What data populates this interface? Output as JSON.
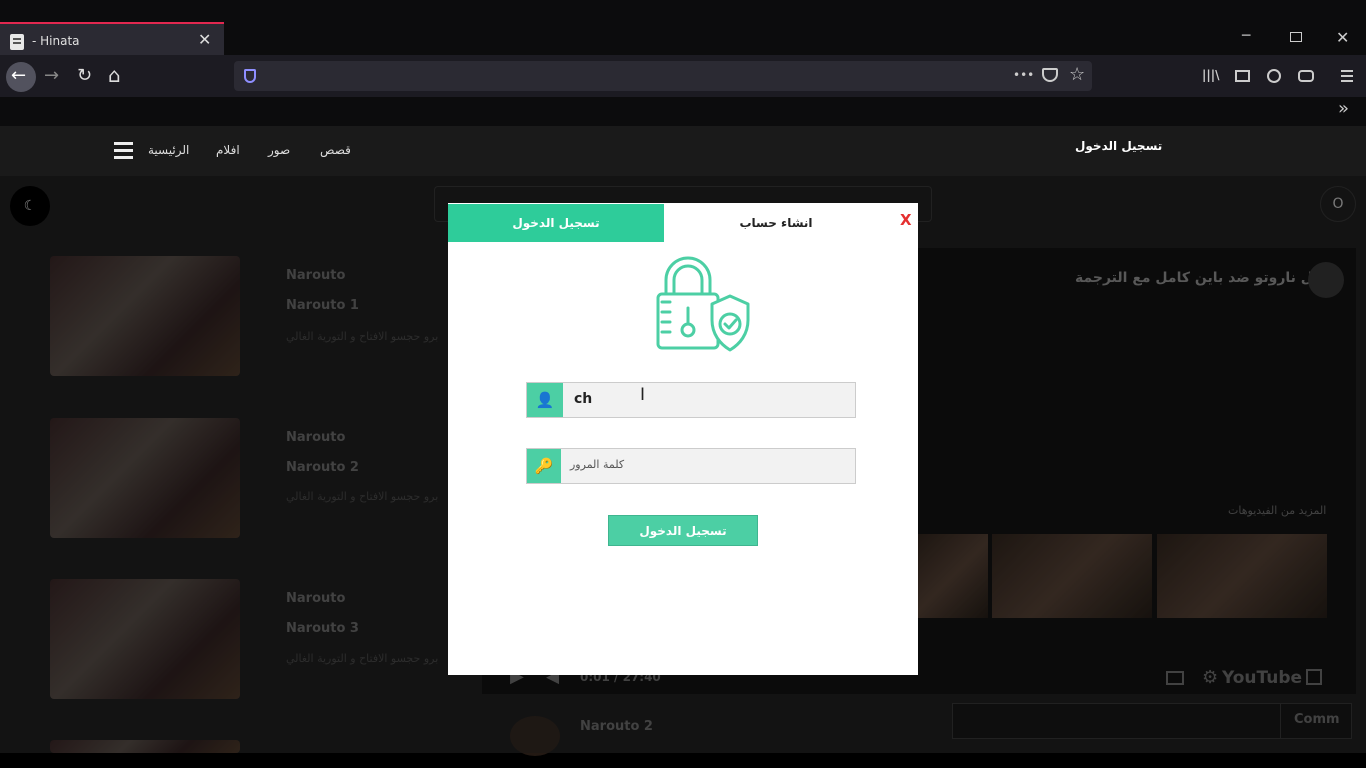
{
  "browser": {
    "tab_title": "- Hinata",
    "tab_close": "✕",
    "window_min": "─",
    "window_close": "✕",
    "nav_back": "←",
    "nav_forward": "→",
    "nav_reload": "↻",
    "nav_home": "⌂",
    "page_actions": "•••",
    "library": "|||\\",
    "bookmarks_more": "»"
  },
  "site_header": {
    "nav_links": [
      "الرئيسية",
      "افلام",
      "صور",
      "قصص"
    ],
    "login_link": "تسجيل الدخول"
  },
  "page": {
    "moon_icon": "☾",
    "circle_label": "O",
    "cards": [
      {
        "title": "Narouto",
        "subtitle": "Narouto 1",
        "desc": "برو حجسو الافتاح و التورية الغالي"
      },
      {
        "title": "Narouto",
        "subtitle": "Narouto 2",
        "desc": "برو حجسو الافتاح و التورية الغالي"
      },
      {
        "title": "Narouto",
        "subtitle": "Narouto 3",
        "desc": "برو حجسو الافتاح و التورية الغالي"
      }
    ],
    "video_title": "قتال ناروتو ضد باين كامل مع الترجمة",
    "more_videos": "المزيد من الفيديوهات",
    "timecode": "0:01 / 27:40",
    "youtube": "YouTube",
    "comment_button": "Comm",
    "comment_author": "Narouto 2"
  },
  "modal": {
    "tab_login": "تسجيل الدخول",
    "tab_signup": "انشاء حساب",
    "close": "X",
    "username_value": "ch",
    "password_placeholder": "كلمة المرور",
    "submit": "تسجيل الدخول",
    "accent_color": "#4ccfa4"
  }
}
